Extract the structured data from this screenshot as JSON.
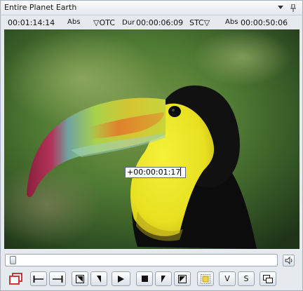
{
  "window": {
    "title": "Entire Planet Earth"
  },
  "timecodes": {
    "current": "00:01:14:14",
    "current_mode": "Abs",
    "otc_label": "▽OTC",
    "dur_label": "Dur",
    "duration": "00:00:06:09",
    "stc_label": "STC▽",
    "end_mode": "Abs",
    "end": "00:00:50:06"
  },
  "overlay": {
    "timecode": "+00:00:01:17"
  },
  "scrubber": {
    "position": 0.0
  },
  "buttons": {
    "video_label": "V",
    "sync_label": "S"
  },
  "colors": {
    "accent": "#d0343a",
    "border": "#97a3b3"
  }
}
